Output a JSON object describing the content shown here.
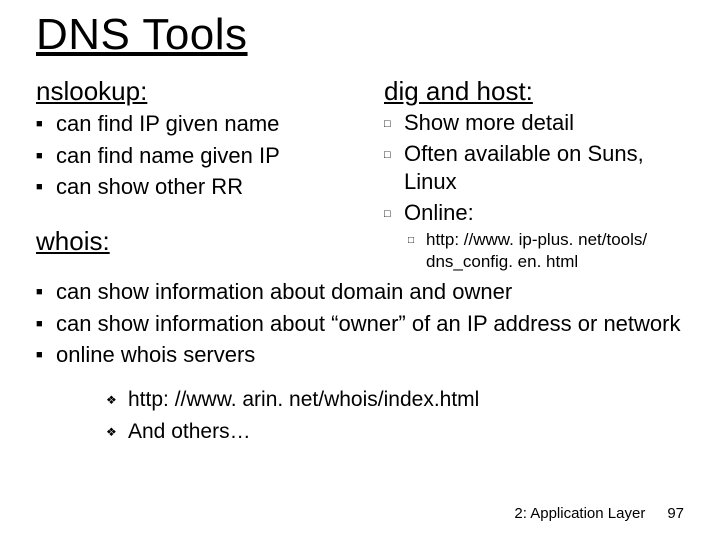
{
  "title": "DNS Tools",
  "left": {
    "nslookup": {
      "heading": "nslookup:",
      "items": [
        "can find IP given name",
        "can find name given IP",
        "can show other RR"
      ]
    },
    "whois_heading": "whois:"
  },
  "right": {
    "dighost": {
      "heading": "dig and host:",
      "items": [
        "Show more detail",
        "Often available on Suns, Linux",
        "Online:"
      ],
      "sub": [
        "http: //www. ip-plus. net/tools/ dns_config. en. html"
      ]
    }
  },
  "whois_items": [
    "can show information about domain and owner",
    "can show information about “owner” of an IP address or network",
    "online whois servers"
  ],
  "whois_sub": [
    "http: //www. arin. net/whois/index.html",
    "And others…"
  ],
  "footer": {
    "section": "2: Application Layer",
    "page": "97"
  },
  "bullets": {
    "filled_square": "■",
    "hollow_square": "□",
    "diamond": "❖"
  }
}
